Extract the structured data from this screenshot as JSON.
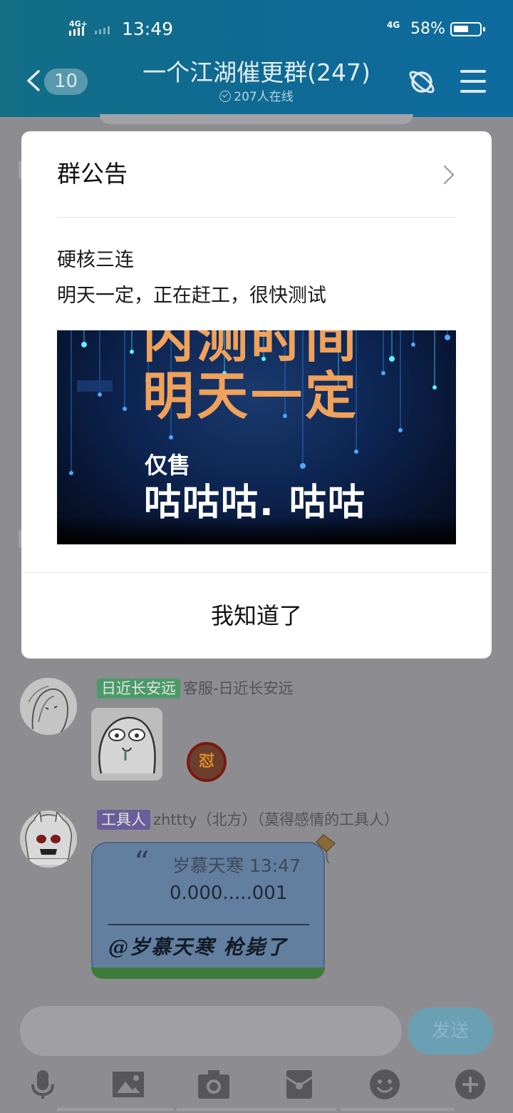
{
  "status_bar": {
    "network_left": "4G+",
    "time": "13:49",
    "network_right": "4G",
    "battery": "58%",
    "battery_level": 0.58
  },
  "header": {
    "unread_count": "10",
    "group_title": "一个江湖催更群(247)",
    "online_text": "207人在线"
  },
  "dialog": {
    "title": "群公告",
    "lines": [
      "硬核三连",
      "明天一定，正在赶工，很快测试"
    ],
    "image_text": {
      "top": "内测时间",
      "big": "明天一定",
      "small": "仅售",
      "mid": "咕咕咕. 咕咕"
    },
    "confirm_label": "我知道了"
  },
  "messages": [
    {
      "tag": "日近长安远",
      "tag_color": "#4c9a6a",
      "sender": "客服-日近长安远",
      "reaction": "怼"
    },
    {
      "tag": "工具人",
      "tag_color": "#6a5e99",
      "sender": "zhttty（北方）（莫得感情的工具人）",
      "quote_source": "岁慕天寒 13:47",
      "quote_text": "0.000.....001",
      "reply": "@岁慕天寒 枪毙了"
    }
  ],
  "input": {
    "placeholder": "",
    "send_label": "发送"
  },
  "toolbar": {
    "icons": [
      "microphone-icon",
      "image-icon",
      "camera-icon",
      "red-packet-icon",
      "emoji-icon",
      "plus-icon"
    ]
  }
}
